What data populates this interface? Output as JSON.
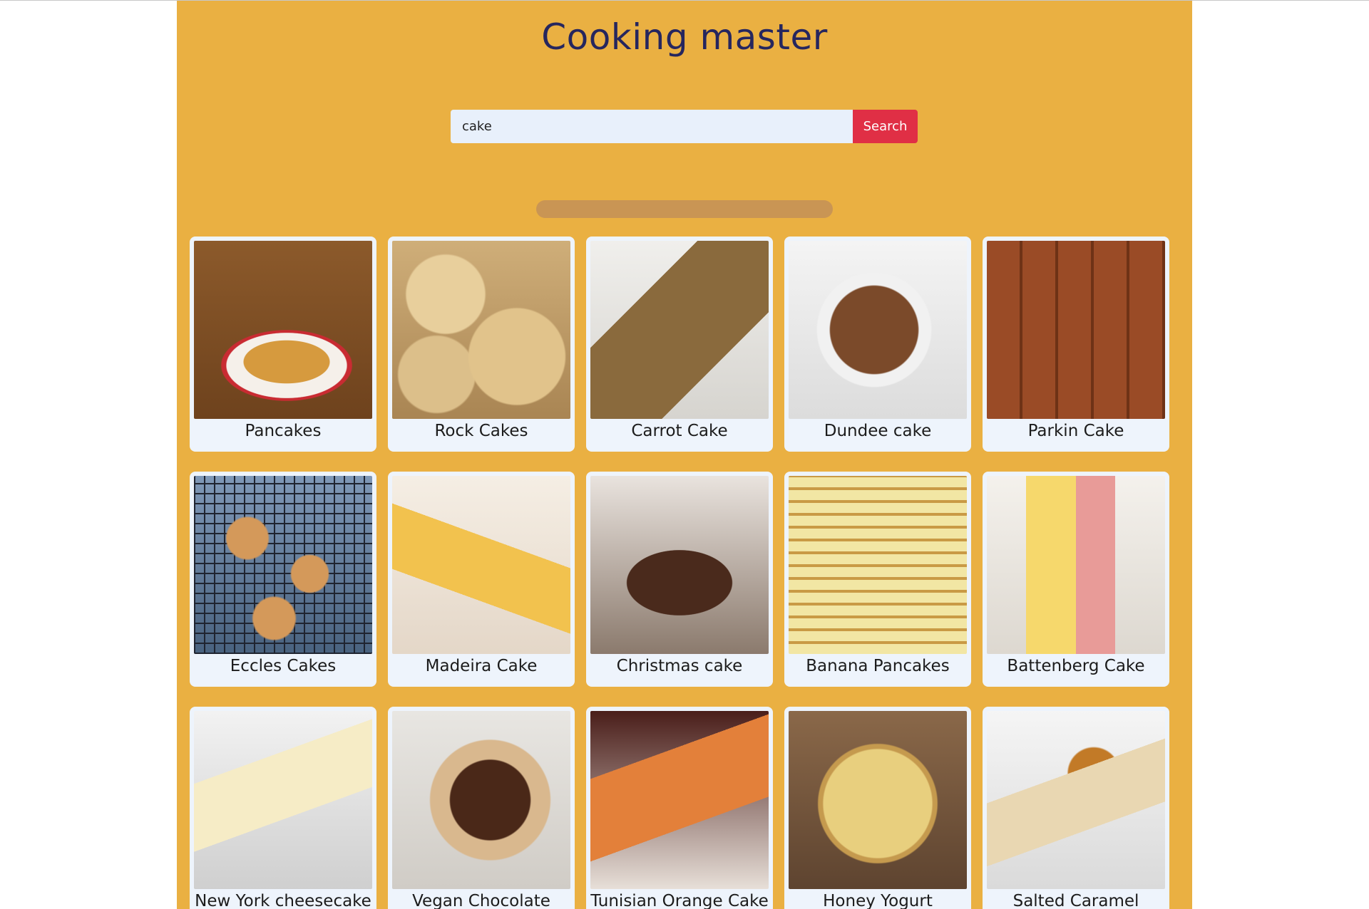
{
  "app": {
    "title": "Cooking master"
  },
  "search": {
    "value": "cake",
    "button_label": "Search"
  },
  "results": [
    {
      "name": "Pancakes"
    },
    {
      "name": "Rock Cakes"
    },
    {
      "name": "Carrot Cake"
    },
    {
      "name": "Dundee cake"
    },
    {
      "name": "Parkin Cake"
    },
    {
      "name": "Eccles Cakes"
    },
    {
      "name": "Madeira Cake"
    },
    {
      "name": "Christmas cake"
    },
    {
      "name": "Banana Pancakes"
    },
    {
      "name": "Battenberg Cake"
    },
    {
      "name": "New York cheesecake"
    },
    {
      "name": "Vegan Chocolate"
    },
    {
      "name": "Tunisian Orange Cake"
    },
    {
      "name": "Honey Yogurt"
    },
    {
      "name": "Salted Caramel"
    }
  ],
  "colors": {
    "panel_background": "#eab042",
    "title": "#26265e",
    "search_button": "#e02f45",
    "card_background": "#eef4fc"
  }
}
